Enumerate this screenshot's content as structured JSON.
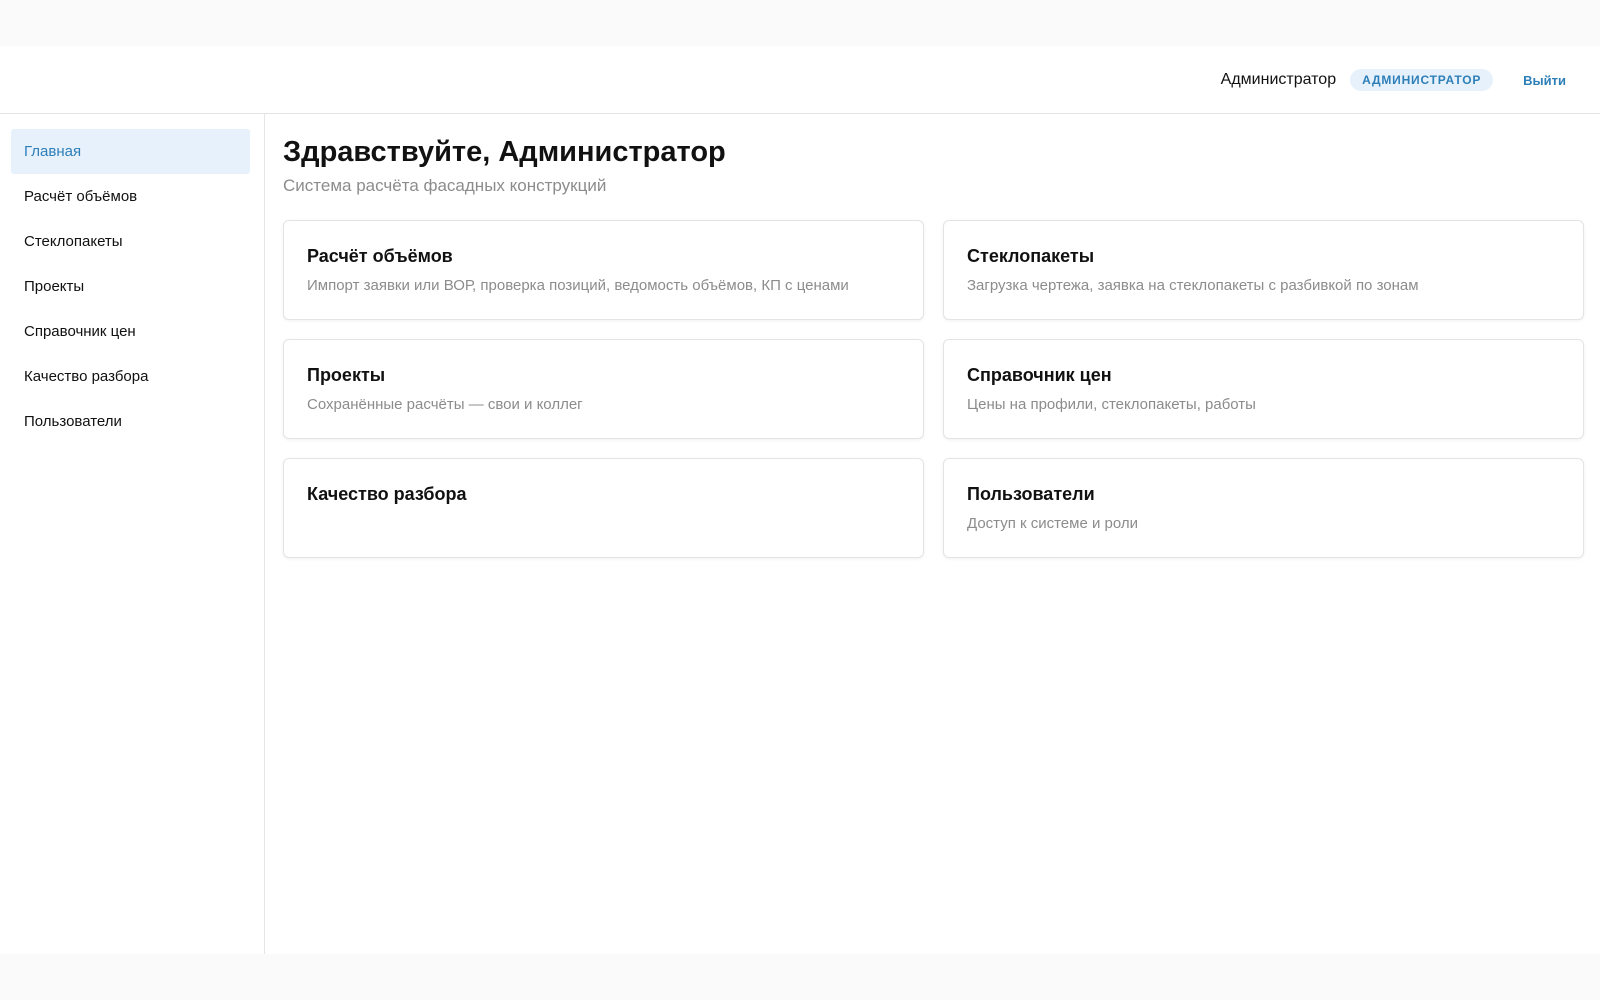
{
  "header": {
    "user_name": "Администратор",
    "role_badge": "Администратор",
    "logout_label": "Выйти"
  },
  "sidebar": {
    "items": [
      {
        "label": "Главная",
        "active": true
      },
      {
        "label": "Расчёт объёмов",
        "active": false
      },
      {
        "label": "Стеклопакеты",
        "active": false
      },
      {
        "label": "Проекты",
        "active": false
      },
      {
        "label": "Справочник цен",
        "active": false
      },
      {
        "label": "Качество разбора",
        "active": false
      },
      {
        "label": "Пользователи",
        "active": false
      }
    ]
  },
  "main": {
    "title": "Здравствуйте, Администратор",
    "subtitle": "Система расчёта фасадных конструкций",
    "cards": [
      {
        "title": "Расчёт объёмов",
        "description": "Импорт заявки или ВОР, проверка позиций, ведомость объёмов, КП с ценами"
      },
      {
        "title": "Стеклопакеты",
        "description": "Загрузка чертежа, заявка на стеклопакеты с разбивкой по зонам"
      },
      {
        "title": "Проекты",
        "description": "Сохранённые расчёты — свои и коллег"
      },
      {
        "title": "Справочник цен",
        "description": "Цены на профили, стеклопакеты, работы"
      },
      {
        "title": "Качество разбора",
        "description": ""
      },
      {
        "title": "Пользователи",
        "description": "Доступ к системе и роли"
      }
    ]
  },
  "colors": {
    "accent": "#2d7fb8",
    "accent_bg": "#e6f1fb",
    "muted_text": "#8c8c8c",
    "border": "#e4e4e4"
  }
}
